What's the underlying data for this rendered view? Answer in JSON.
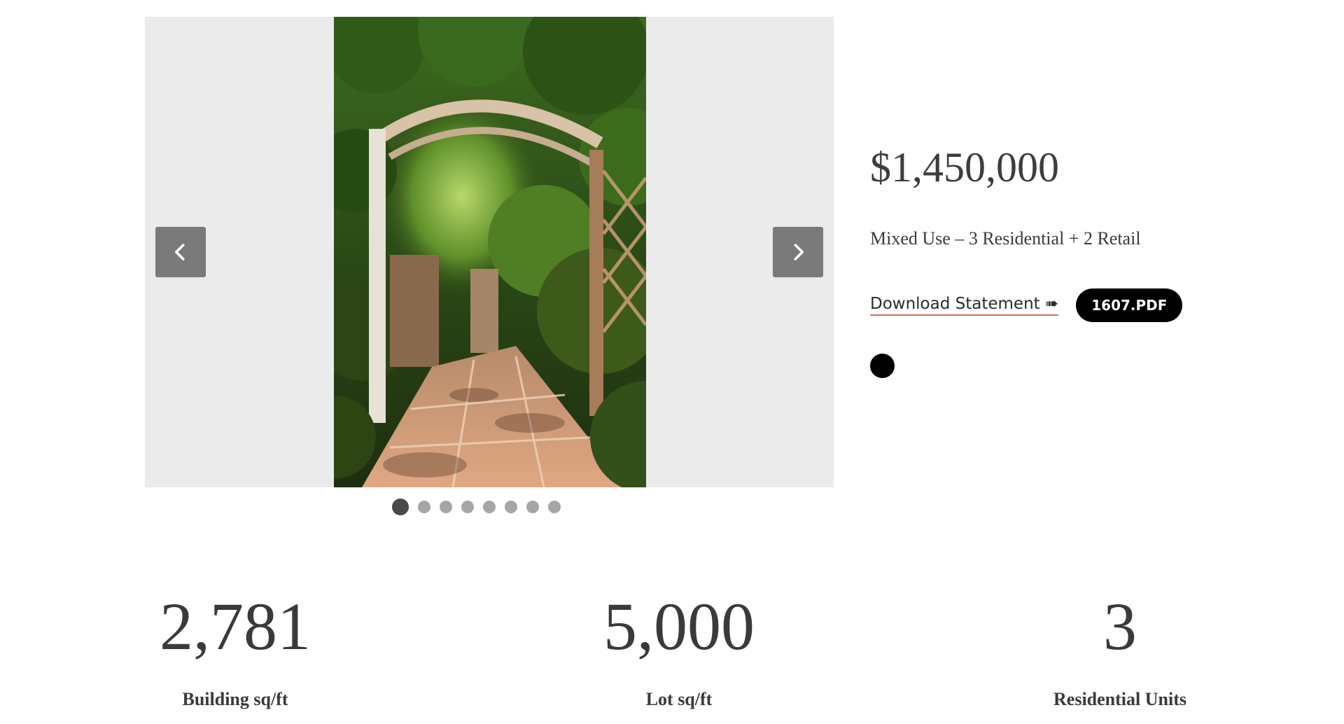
{
  "carousel": {
    "prev_icon": "chevron-left-icon",
    "next_icon": "chevron-right-icon",
    "slide_count": 8,
    "active_slide": 1
  },
  "listing": {
    "price": "$1,450,000",
    "type": "Mixed Use – 3 Residential + 2 Retail",
    "download_label": "Download Statement ➠",
    "pdf_label": "1607.PDF"
  },
  "stats": [
    {
      "value": "2,781",
      "label": "Building sq/ft"
    },
    {
      "value": "5,000",
      "label": "Lot sq/ft"
    },
    {
      "value": "3",
      "label": "Residential Units"
    }
  ]
}
